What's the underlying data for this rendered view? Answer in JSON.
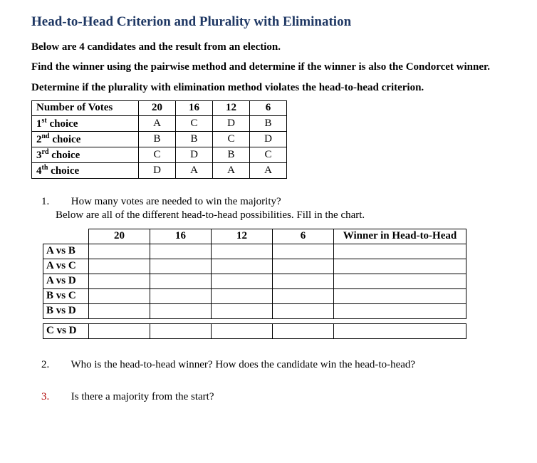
{
  "title": "Head-to-Head Criterion and Plurality with Elimination",
  "intro": {
    "line1": "Below are 4 candidates and the result from an election.",
    "line2": "Find the winner using the pairwise method and determine if the winner is also the Condorcet winner.",
    "line3": "Determine if the plurality with elimination method violates the head-to-head criterion."
  },
  "votes_table": {
    "header_label": "Number of Votes",
    "columns": [
      "20",
      "16",
      "12",
      "6"
    ],
    "rows": [
      {
        "label_pre": "1",
        "label_sup": "st",
        "label_post": " choice",
        "cells": [
          "A",
          "C",
          "D",
          "B"
        ]
      },
      {
        "label_pre": "2",
        "label_sup": "nd",
        "label_post": " choice",
        "cells": [
          "B",
          "B",
          "C",
          "D"
        ]
      },
      {
        "label_pre": "3",
        "label_sup": "rd",
        "label_post": " choice",
        "cells": [
          "C",
          "D",
          "B",
          "C"
        ]
      },
      {
        "label_pre": "4",
        "label_sup": "th",
        "label_post": " choice",
        "cells": [
          "D",
          "A",
          "A",
          "A"
        ]
      }
    ]
  },
  "q1": {
    "num": "1.",
    "text": "How many votes are needed to win the majority?",
    "subtext": "Below are all of the different head-to-head possibilities. Fill in the chart."
  },
  "h2h_table": {
    "columns": [
      "20",
      "16",
      "12",
      "6"
    ],
    "winner_header": "Winner in Head-to-Head",
    "pairs": [
      "A vs B",
      "A vs C",
      "A vs D",
      "B vs C",
      "B vs D"
    ],
    "gap_pair": "C vs D"
  },
  "q2": {
    "num": "2.",
    "text": "Who is the head-to-head winner? How does the candidate win the head-to-head?"
  },
  "q3": {
    "num": "3.",
    "text": "Is there a majority from the start?"
  }
}
